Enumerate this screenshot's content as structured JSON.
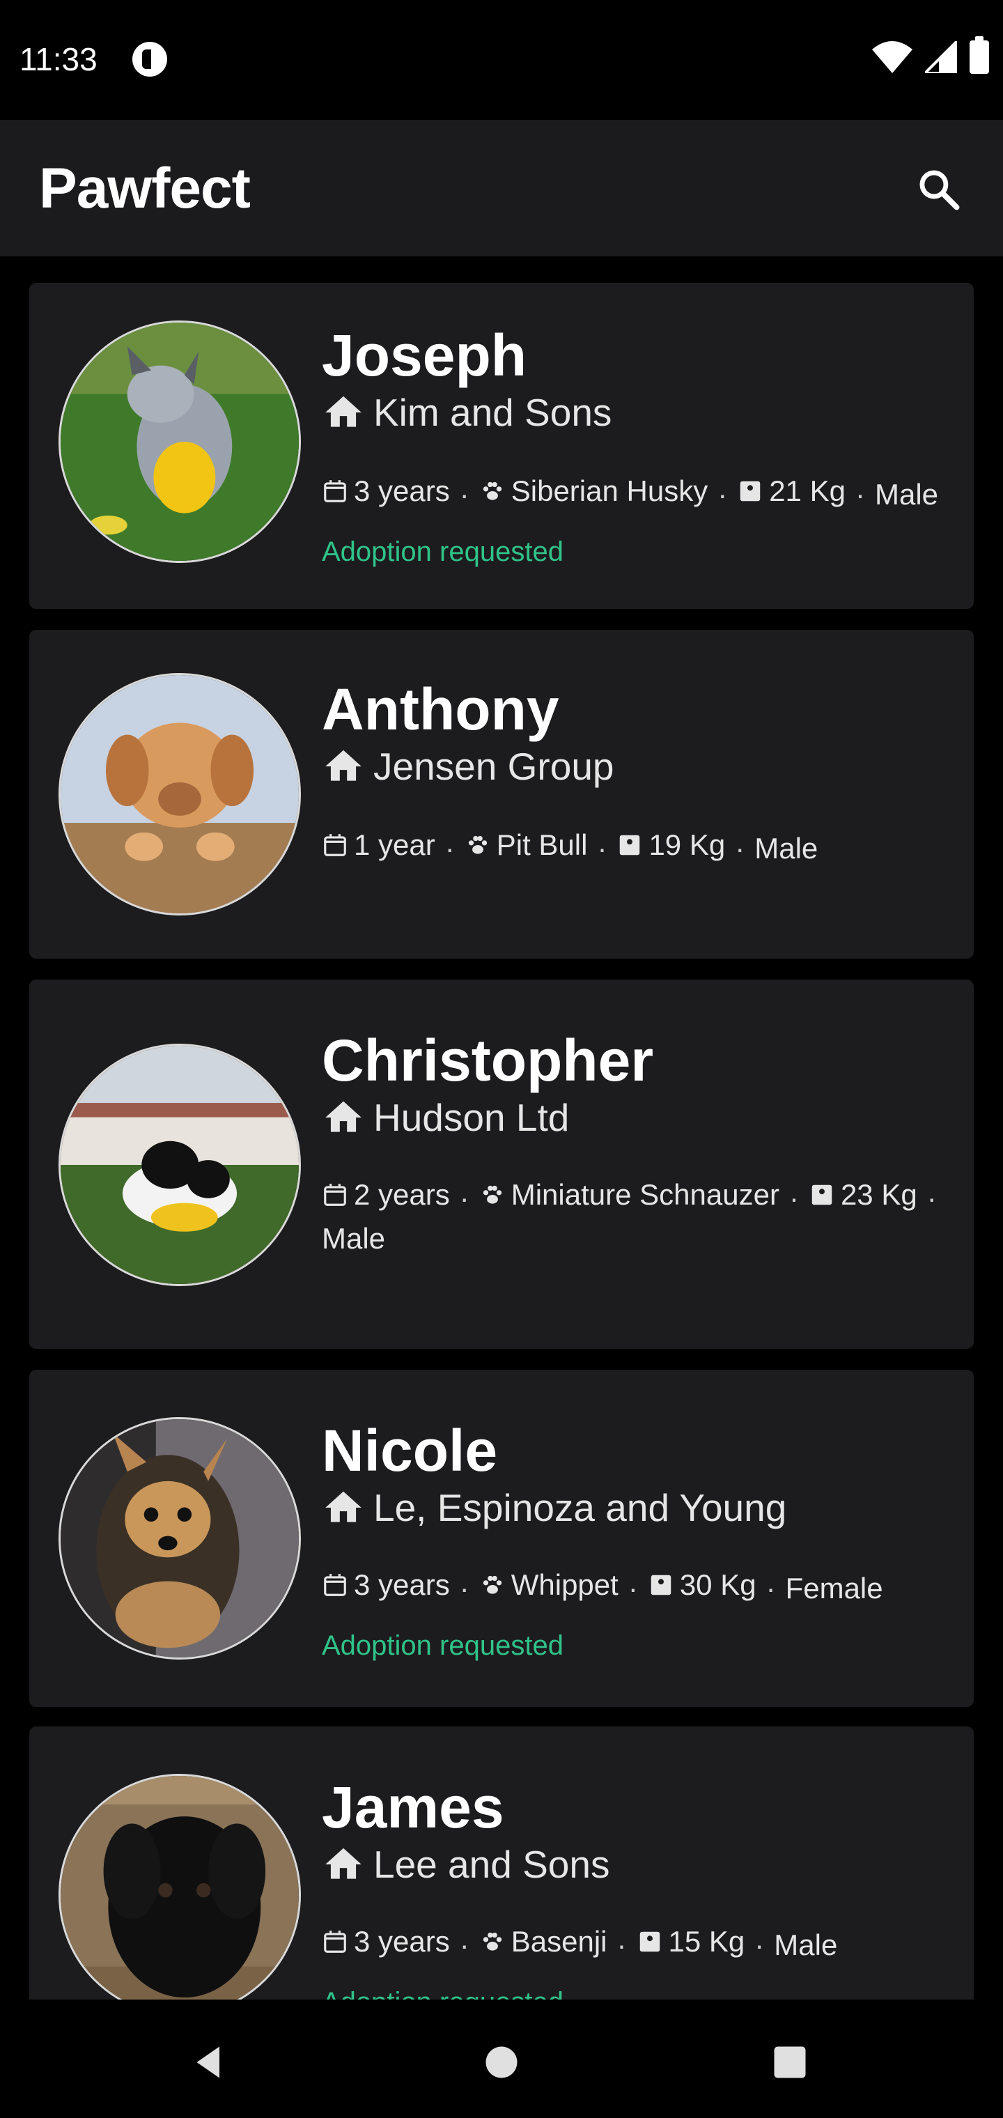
{
  "status_bar": {
    "time": "11:33"
  },
  "app_bar": {
    "title": "Pawfect",
    "search_icon": "search-icon"
  },
  "colors": {
    "background": "#000000",
    "card": "#1c1c1e",
    "accent_green": "#2fc38a"
  },
  "pets": [
    {
      "name": "Joseph",
      "shelter": "Kim and Sons",
      "age": "3 years",
      "breed": "Siberian Husky",
      "weight": "21 Kg",
      "gender": "Male",
      "status": "Adoption requested"
    },
    {
      "name": "Anthony",
      "shelter": "Jensen Group",
      "age": "1 year",
      "breed": "Pit Bull",
      "weight": "19 Kg",
      "gender": "Male",
      "status": ""
    },
    {
      "name": "Christopher",
      "shelter": "Hudson Ltd",
      "age": "2 years",
      "breed": "Miniature Schnauzer",
      "weight": "23 Kg",
      "gender": "Male",
      "status": ""
    },
    {
      "name": "Nicole",
      "shelter": "Le, Espinoza and Young",
      "age": "3 years",
      "breed": "Whippet",
      "weight": "30 Kg",
      "gender": "Female",
      "status": "Adoption requested"
    },
    {
      "name": "James",
      "shelter": "Lee and Sons",
      "age": "3 years",
      "breed": "Basenji",
      "weight": "15 Kg",
      "gender": "Male",
      "status": "Adoption requested"
    }
  ],
  "nav_bar": {
    "back_icon": "back-icon",
    "home_icon": "home-circle-icon",
    "recents_icon": "recents-square-icon"
  }
}
